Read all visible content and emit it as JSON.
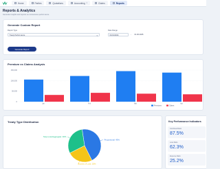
{
  "nav": {
    "items": [
      {
        "label": "Home",
        "icon": "home-icon"
      },
      {
        "label": "Parties",
        "icon": "users-icon"
      },
      {
        "label": "Quotations",
        "icon": "document-icon"
      },
      {
        "label": "Accounting",
        "icon": "calculator-icon"
      },
      {
        "label": "Claims",
        "icon": "clipboard-icon"
      },
      {
        "label": "Reports",
        "icon": "chart-icon",
        "active": true
      }
    ]
  },
  "page": {
    "title": "Reports & Analytics",
    "subtitle": "Generate insights and reports on reinsurance performance"
  },
  "generate": {
    "title": "Generate Custom Report",
    "report_type_label": "Report Type",
    "report_type_value": "Treaty Performance",
    "date_range_label": "Date Range",
    "date_from": "01/01/2024",
    "date_to": "01.06.2025",
    "button_label": "Generate Report"
  },
  "chart_title": "Premium vs Claims Analysis",
  "chart_data": [
    {
      "type": "bar",
      "categories": [
        "Jan",
        "Feb",
        "Mar",
        "Apr"
      ],
      "series": [
        {
          "name": "Premiums",
          "values": [
            105000,
            122000,
            145000,
            138000
          ],
          "color": "#1f7ef2"
        },
        {
          "name": "Claims",
          "values": [
            32000,
            42000,
            38000,
            35000
          ],
          "color": "#f0344a"
        }
      ],
      "ylim": [
        0,
        150000
      ],
      "yticks": [
        "0",
        "50,000",
        "100,000",
        "150,000"
      ],
      "legend": "bottom-right",
      "grid": true
    },
    {
      "type": "pie",
      "title": "Treaty Type Distribution",
      "labels": [
        "Proportional: 45%",
        "Excess of Loss: 25%",
        "Stop-Loss/Aggregate: 30%"
      ],
      "values": [
        45,
        25,
        30
      ],
      "colors": [
        "#2a78e4",
        "#f5c518",
        "#1ec08a"
      ]
    }
  ],
  "kpi": {
    "title": "Key Performance Indicators",
    "items": [
      {
        "label": "Combined Ratio",
        "value": "87.5%"
      },
      {
        "label": "Loss Ratio",
        "value": "62.3%"
      },
      {
        "label": "Expense Ratio",
        "value": "25.2%"
      }
    ]
  }
}
